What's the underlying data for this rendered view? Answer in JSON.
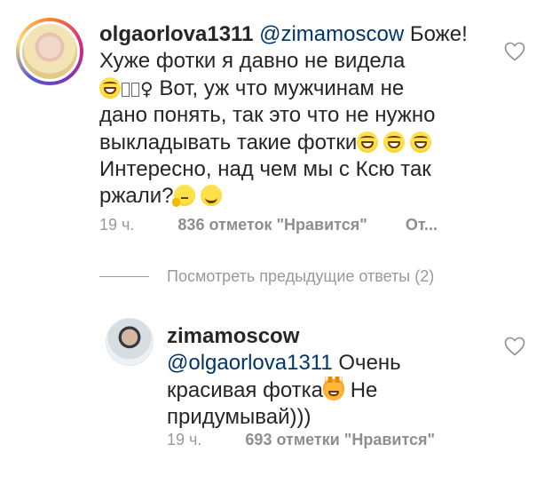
{
  "comment1": {
    "username": "olgaorlova1311",
    "mention": "@zimamoscow",
    "line1_after_mention": "Боже!",
    "line2": "Хуже фотки я давно не видела",
    "line3_after_emoji": "Вот, уж что мужчинам не",
    "line4": "дано понять, так это что не нужно",
    "line5": "выкладывать такие фотки",
    "line6": "Интересно, над чем мы с Ксю так",
    "line7": "ржали?",
    "time": "19 ч.",
    "likes": "836 отметок \"Нравится\"",
    "reply": "От..."
  },
  "view_previous": "Посмотреть предыдущие ответы (2)",
  "comment2": {
    "username": "zimamoscow",
    "mention": "@olgaorlova1311",
    "line2_after_mention": "Очень",
    "line3_before_emoji": "красивая фотка",
    "line3_after_emoji": "Не",
    "line4": "придумывай)))",
    "time": "19 ч.",
    "likes": "693 отметки \"Нравится\""
  },
  "icons": {
    "heart": "heart-outline-icon",
    "emoji_laugh": "grinning-squinting-face-icon",
    "emoji_think": "thinking-face-icon",
    "emoji_smile": "smiling-face-icon",
    "emoji_cat": "grinning-cat-icon"
  },
  "colors": {
    "text": "#262626",
    "mention": "#003569",
    "secondary": "#999999"
  }
}
